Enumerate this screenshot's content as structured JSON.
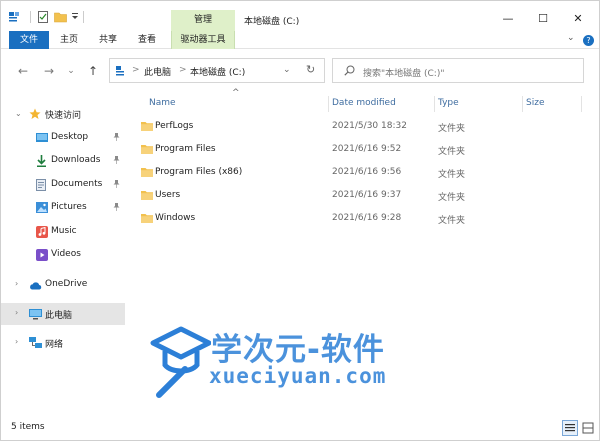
{
  "window": {
    "title": "本地磁盘 (C:)",
    "context_tab": "管理",
    "min_glyph": "—",
    "max_glyph": "☐",
    "close_glyph": "✕"
  },
  "ribbon": {
    "tabs": [
      "文件",
      "主页",
      "共享",
      "查看",
      "驱动器工具"
    ],
    "right_chevron": "⌄",
    "help": "?"
  },
  "address": {
    "root": "此电脑",
    "separator": ">",
    "current": "本地磁盘 (C:)",
    "dropdown": "⌄",
    "refresh": "↻",
    "search_placeholder": "搜索\"本地磁盘 (C:)\""
  },
  "nav": {
    "back": "←",
    "forward": "→",
    "recent": "⌄",
    "up": "↑"
  },
  "sidebar": {
    "quick_access": "快速访问",
    "items": [
      {
        "label": "Desktop",
        "icon": "desktop-icon",
        "pinned": true
      },
      {
        "label": "Downloads",
        "icon": "download-icon",
        "pinned": true
      },
      {
        "label": "Documents",
        "icon": "documents-icon",
        "pinned": true
      },
      {
        "label": "Pictures",
        "icon": "pictures-icon",
        "pinned": true
      },
      {
        "label": "Music",
        "icon": "music-icon",
        "pinned": false
      },
      {
        "label": "Videos",
        "icon": "videos-icon",
        "pinned": false
      }
    ],
    "onedrive": "OneDrive",
    "this_pc": "此电脑",
    "network": "网络",
    "pin_glyph": "📌"
  },
  "columns": {
    "name": "Name",
    "date": "Date modified",
    "type": "Type",
    "size": "Size",
    "sort_caret": "^"
  },
  "files": [
    {
      "name": "PerfLogs",
      "date": "2021/5/30 18:32",
      "type": "文件夹"
    },
    {
      "name": "Program Files",
      "date": "2021/6/16 9:52",
      "type": "文件夹"
    },
    {
      "name": "Program Files (x86)",
      "date": "2021/6/16 9:56",
      "type": "文件夹"
    },
    {
      "name": "Users",
      "date": "2021/6/16 9:37",
      "type": "文件夹"
    },
    {
      "name": "Windows",
      "date": "2021/6/16 9:28",
      "type": "文件夹"
    }
  ],
  "watermark": {
    "cn": "学次元-软件",
    "en": "xueciyuan.com"
  },
  "status": {
    "count": "5 items"
  },
  "colors": {
    "accent": "#1a6fc0",
    "context": "#dff0c9",
    "folder": "#f2c14e",
    "watermark": "#2c7fd7"
  }
}
